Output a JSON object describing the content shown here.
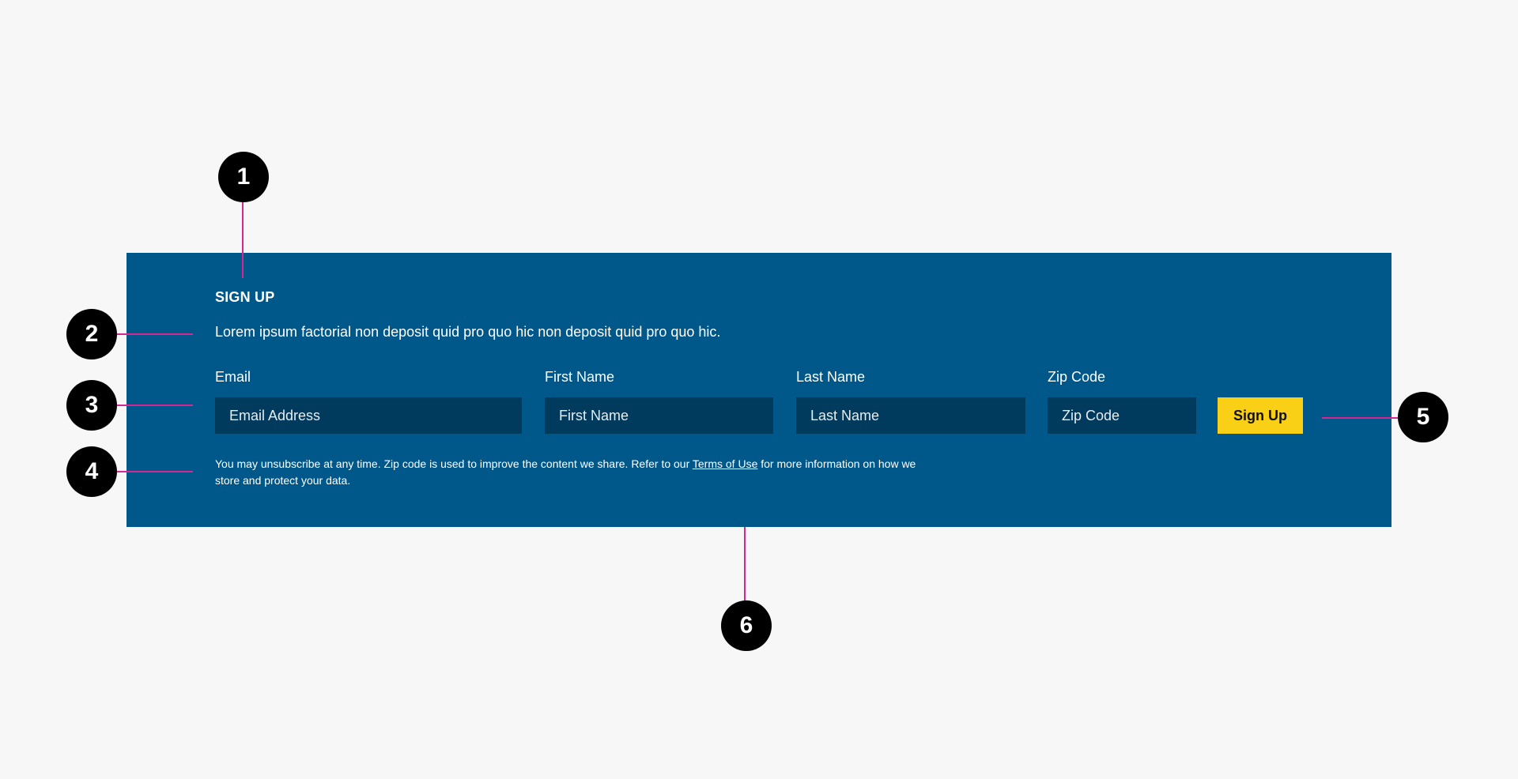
{
  "signup": {
    "heading": "SIGN UP",
    "description": "Lorem ipsum factorial non deposit quid pro quo hic non deposit quid pro quo hic.",
    "fields": [
      {
        "label": "Email",
        "placeholder": "Email Address"
      },
      {
        "label": "First Name",
        "placeholder": "First Name"
      },
      {
        "label": "Last Name",
        "placeholder": "Last Name"
      },
      {
        "label": "Zip Code",
        "placeholder": "Zip Code"
      }
    ],
    "button_label": "Sign Up",
    "disclaimer": {
      "before_link": "You may unsubscribe at any time. Zip code is used to improve the content we share. Refer to our ",
      "link_text": "Terms of Use",
      "after_link": " for more information on how we store and protect your data."
    }
  },
  "callouts": [
    "1",
    "2",
    "3",
    "4",
    "5",
    "6"
  ],
  "colors": {
    "panel": "#00578a",
    "input": "#003a5d",
    "button": "#f9d016",
    "leader": "#d6268f",
    "background": "#f7f7f7"
  }
}
